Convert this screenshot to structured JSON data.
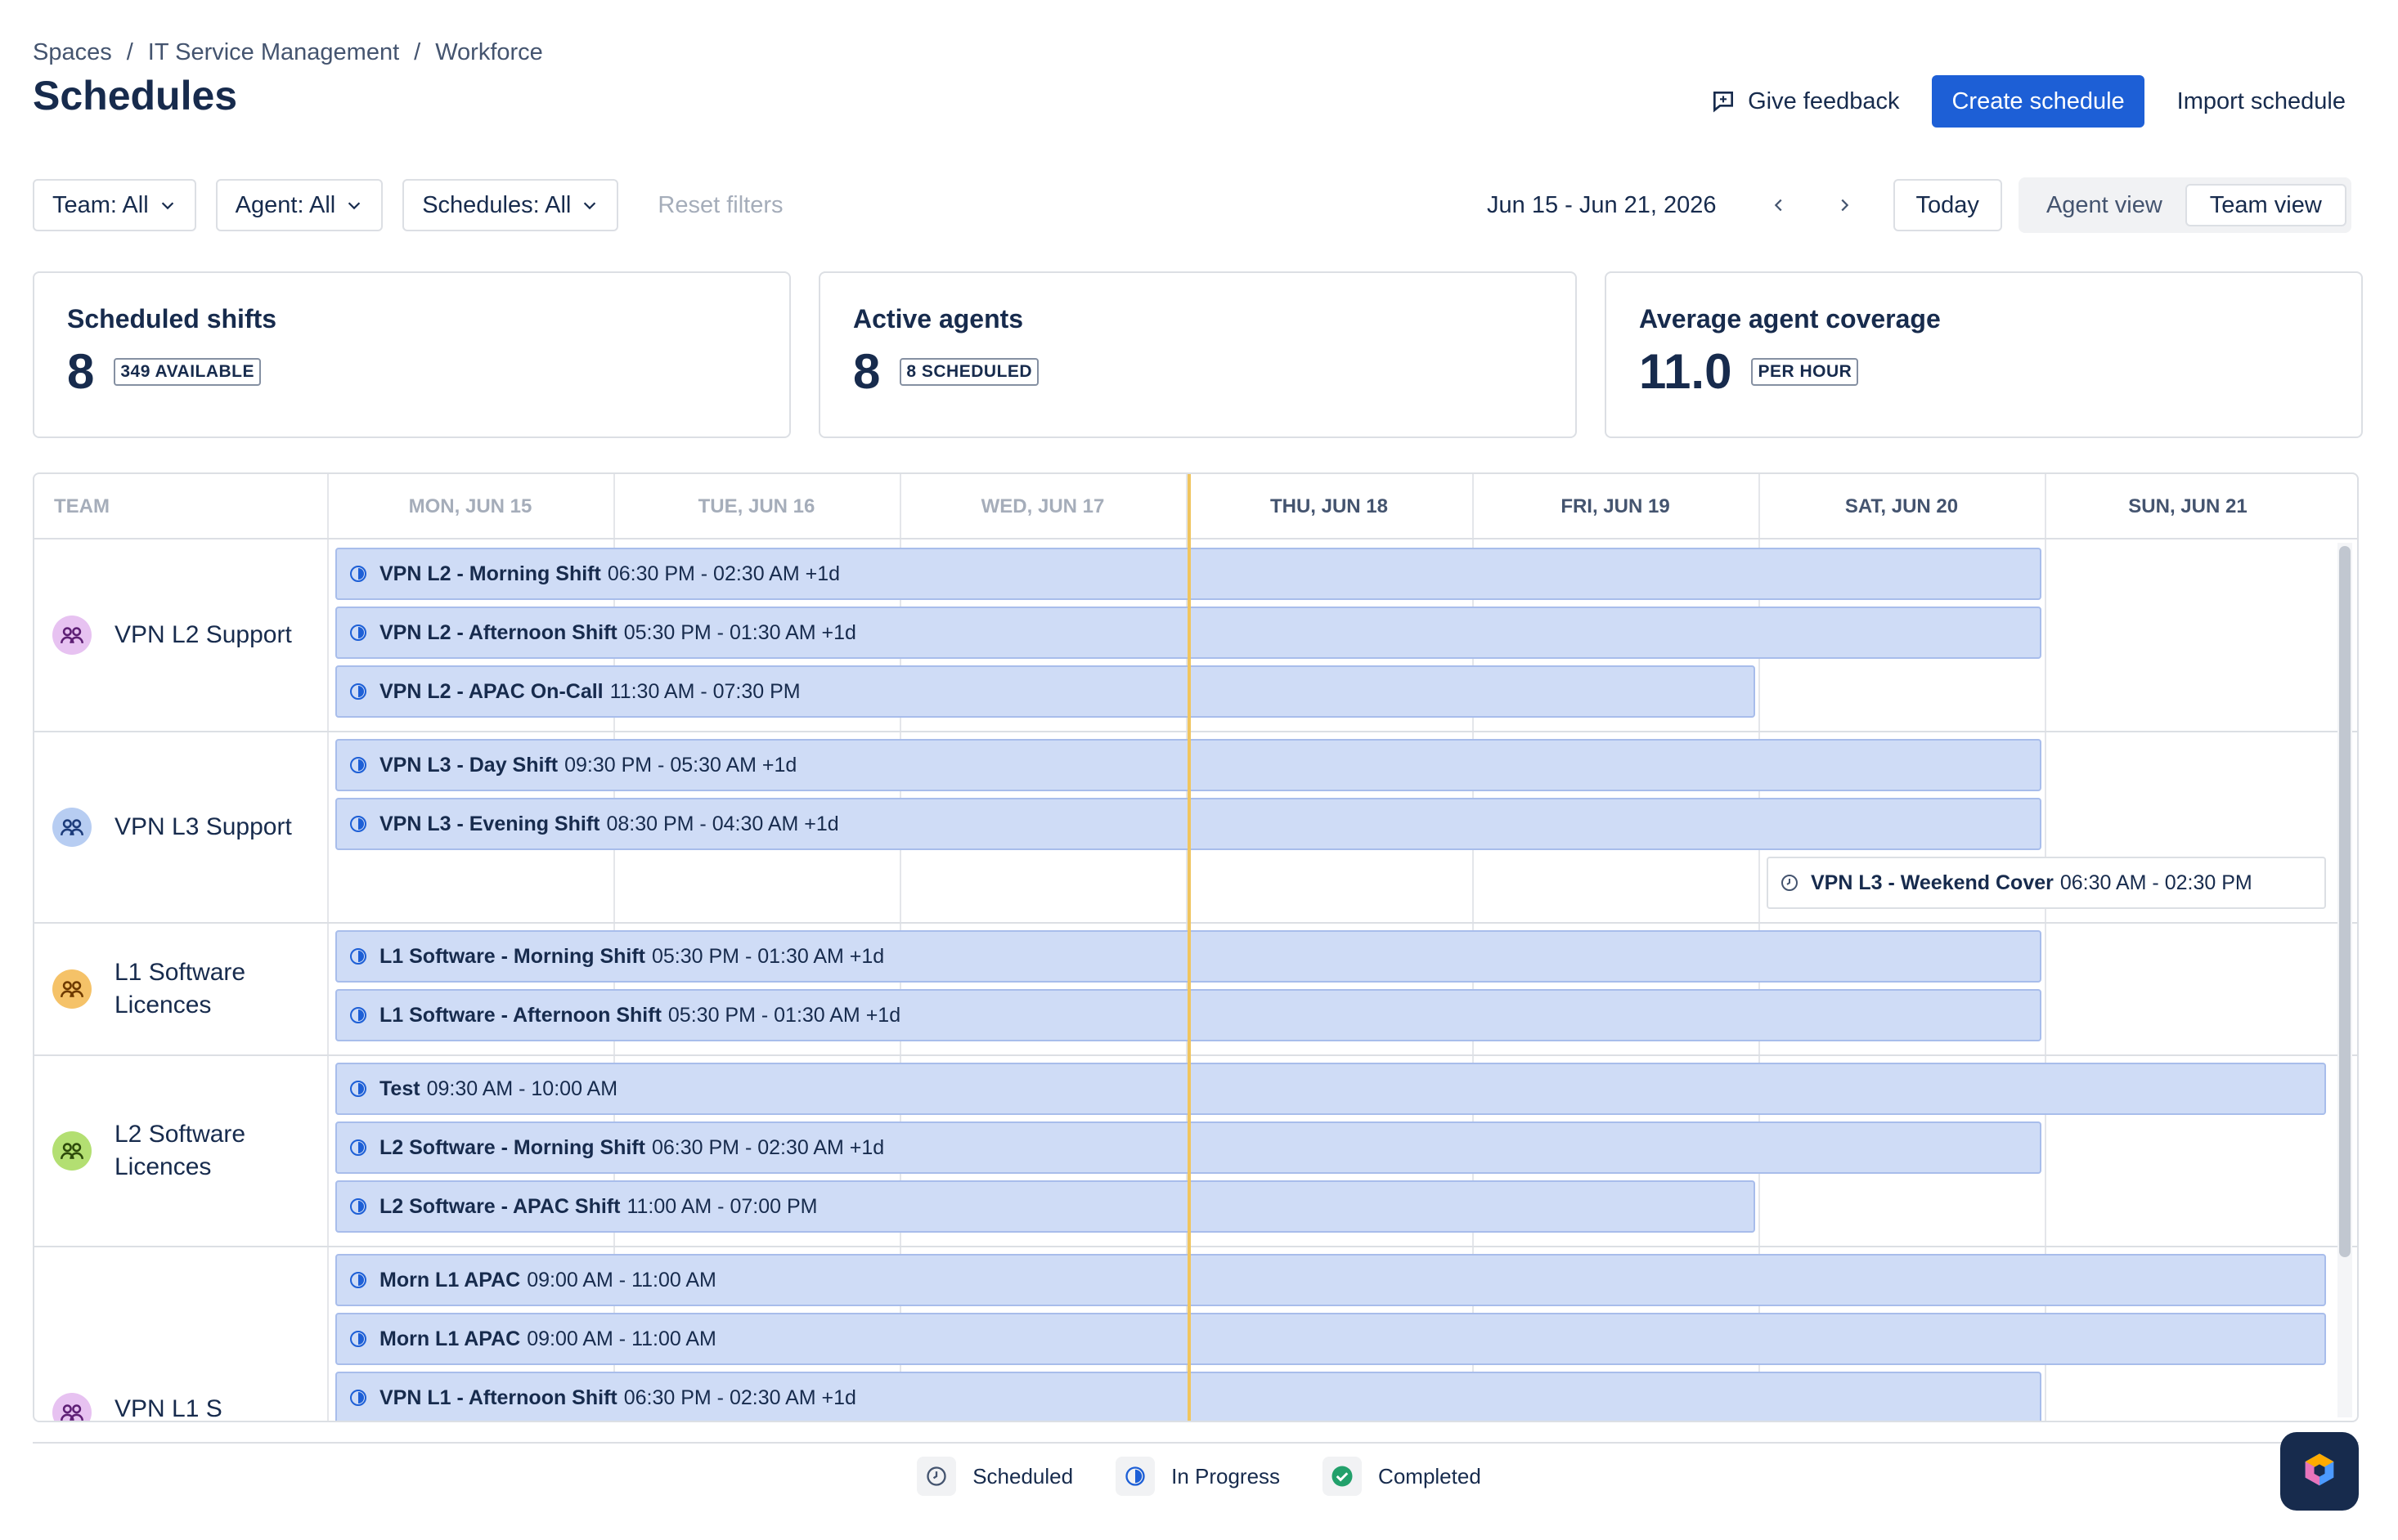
{
  "breadcrumb": {
    "items": [
      "Spaces",
      "IT Service Management",
      "Workforce"
    ],
    "separator": "/"
  },
  "page_title": "Schedules",
  "header": {
    "feedback_label": "Give feedback",
    "create_label": "Create schedule",
    "import_label": "Import schedule"
  },
  "filters": {
    "team": "Team: All",
    "agent": "Agent: All",
    "schedules": "Schedules: All",
    "reset": "Reset filters"
  },
  "date_nav": {
    "range": "Jun 15 - Jun 21, 2026",
    "today_label": "Today",
    "views": [
      "Agent view",
      "Team view"
    ],
    "active_view": "Team view"
  },
  "stats": [
    {
      "title": "Scheduled shifts",
      "value": "8",
      "badge": "349 AVAILABLE"
    },
    {
      "title": "Active agents",
      "value": "8",
      "badge": "8 SCHEDULED"
    },
    {
      "title": "Average agent coverage",
      "value": "11.0",
      "badge": "PER HOUR"
    }
  ],
  "grid": {
    "team_header": "TEAM",
    "days": [
      "MON, JUN 15",
      "TUE, JUN 16",
      "WED, JUN 17",
      "THU, JUN 18",
      "FRI, JUN 19",
      "SAT, JUN 20",
      "SUN, JUN 21"
    ],
    "teams": [
      {
        "name": "VPN L2 Support",
        "color": "#c77ddb"
      },
      {
        "name": "VPN L3 Support",
        "color": "#6d92d9"
      },
      {
        "name": "L1 Software Licences",
        "color": "#f0a73c"
      },
      {
        "name": "L2 Software Licences",
        "color": "#94c748"
      },
      {
        "name": "VPN L1 S",
        "color": "#c77ddb"
      }
    ],
    "shifts": [
      {
        "name": "VPN L2 - Morning Shift",
        "time": "06:30 PM - 02:30 AM +1d",
        "status": "In Progress"
      },
      {
        "name": "VPN L2 - Afternoon Shift",
        "time": "05:30 PM - 01:30 AM +1d",
        "status": "In Progress"
      },
      {
        "name": "VPN L2 - APAC On-Call",
        "time": "11:30 AM - 07:30 PM",
        "status": "In Progress"
      },
      {
        "name": "VPN L3 - Day Shift",
        "time": "09:30 PM - 05:30 AM +1d",
        "status": "In Progress"
      },
      {
        "name": "VPN L3 - Evening Shift",
        "time": "08:30 PM - 04:30 AM +1d",
        "status": "In Progress"
      },
      {
        "name": "VPN L3 - Weekend Cover",
        "time": "06:30 AM - 02:30 PM",
        "status": "Scheduled"
      },
      {
        "name": "L1 Software - Morning Shift",
        "time": "05:30 PM - 01:30 AM +1d",
        "status": "In Progress"
      },
      {
        "name": "L1 Software - Afternoon Shift",
        "time": "05:30 PM - 01:30 AM +1d",
        "status": "In Progress"
      },
      {
        "name": "Test",
        "time": "09:30 AM - 10:00 AM",
        "status": "In Progress"
      },
      {
        "name": "L2 Software - Morning Shift",
        "time": "06:30 PM - 02:30 AM +1d",
        "status": "In Progress"
      },
      {
        "name": "L2 Software - APAC Shift",
        "time": "11:00 AM - 07:00 PM",
        "status": "In Progress"
      },
      {
        "name": "Morn L1 APAC",
        "time": "09:00 AM - 11:00 AM",
        "status": "In Progress"
      },
      {
        "name": "Morn L1 APAC",
        "time": "09:00 AM - 11:00 AM",
        "status": "In Progress"
      },
      {
        "name": "VPN L1 - Afternoon Shift",
        "time": "06:30 PM - 02:30 AM +1d",
        "status": "In Progress"
      }
    ]
  },
  "legend": [
    "Scheduled",
    "In Progress",
    "Completed"
  ],
  "colors": {
    "primary": "#1d5fd6",
    "shift_fill": "#cfdcf6",
    "today_line": "#f0c55f",
    "completed": "#22a06b"
  }
}
